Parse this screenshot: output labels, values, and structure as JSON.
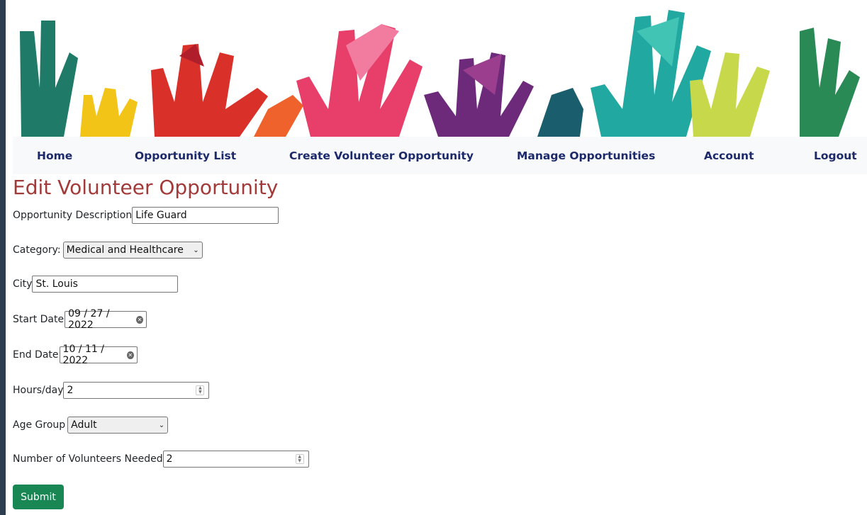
{
  "nav": {
    "items": [
      {
        "label": "Home"
      },
      {
        "label": "Opportunity List"
      },
      {
        "label": "Create Volunteer Opportunity"
      },
      {
        "label": "Manage Opportunities"
      },
      {
        "label": "Account"
      },
      {
        "label": "Logout"
      }
    ]
  },
  "form": {
    "title": "Edit Volunteer Opportunity",
    "description": {
      "label": "Opportunity Description",
      "value": "Life Guard"
    },
    "category": {
      "label": "Category:",
      "value": "Medical and Healthcare"
    },
    "city": {
      "label": "City",
      "value": "St. Louis"
    },
    "start_date": {
      "label": "Start Date",
      "value": "09 / 27 / 2022"
    },
    "end_date": {
      "label": "End Date",
      "value": "10 / 11 / 2022"
    },
    "hours": {
      "label": "Hours/day",
      "value": "2"
    },
    "age_group": {
      "label": "Age Group",
      "value": "Adult"
    },
    "volunteers": {
      "label": "Number of Volunteers Needed",
      "value": "2"
    },
    "submit_label": "Submit"
  },
  "colors": {
    "title": "#a23a3a",
    "nav_text": "#1c2a6b",
    "submit": "#198754"
  }
}
